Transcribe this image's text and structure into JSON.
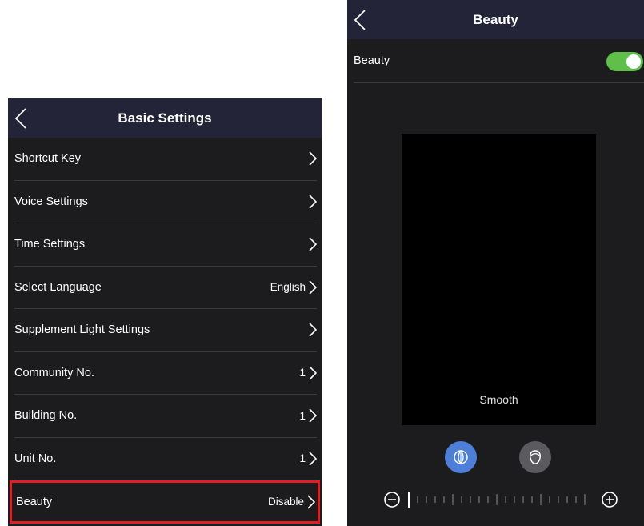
{
  "basic_settings": {
    "title": "Basic Settings",
    "items": [
      {
        "label": "Shortcut Key",
        "value": ""
      },
      {
        "label": "Voice Settings",
        "value": ""
      },
      {
        "label": "Time Settings",
        "value": ""
      },
      {
        "label": "Select Language",
        "value": "English"
      },
      {
        "label": "Supplement Light Settings",
        "value": ""
      },
      {
        "label": "Community No.",
        "value": "1"
      },
      {
        "label": "Building No.",
        "value": "1"
      },
      {
        "label": "Unit No.",
        "value": "1"
      },
      {
        "label": "Beauty",
        "value": "Disable"
      }
    ]
  },
  "beauty_settings": {
    "title": "Beauty",
    "toggle_label": "Beauty",
    "toggle_on": true,
    "preview_caption": "Smooth",
    "modes": [
      "smooth-icon",
      "face-outline-icon"
    ]
  },
  "colors": {
    "header_bg": "#232437",
    "panel_bg": "#1c1c1f",
    "highlight": "#e01f25",
    "toggle_on": "#5fbf4a",
    "mode_active": "#4d7fd9"
  }
}
